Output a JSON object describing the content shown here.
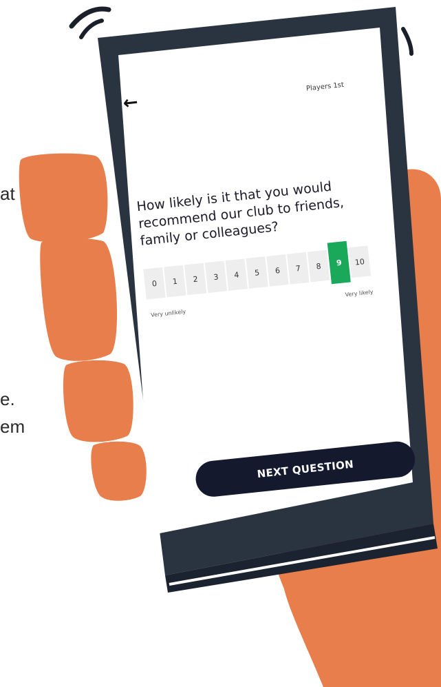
{
  "background_text": {
    "fragment_1": "at",
    "fragment_2": "e.",
    "fragment_3": "em"
  },
  "app": {
    "brand": "Players 1st"
  },
  "survey": {
    "question": "How likely is it that you would recommend our club to friends, family or colleagues?",
    "scale": [
      "0",
      "1",
      "2",
      "3",
      "4",
      "5",
      "6",
      "7",
      "8",
      "9",
      "10"
    ],
    "selected_value": 9,
    "low_label": "Very unlikely",
    "high_label": "Very likely",
    "next_button_label": "NEXT QUESTION"
  },
  "colors": {
    "hand": "#e87e4b",
    "phone_frame": "#2a3340",
    "button": "#14192e",
    "selected": "#1aa85a"
  },
  "icons": {
    "back": "arrow-left-icon"
  }
}
